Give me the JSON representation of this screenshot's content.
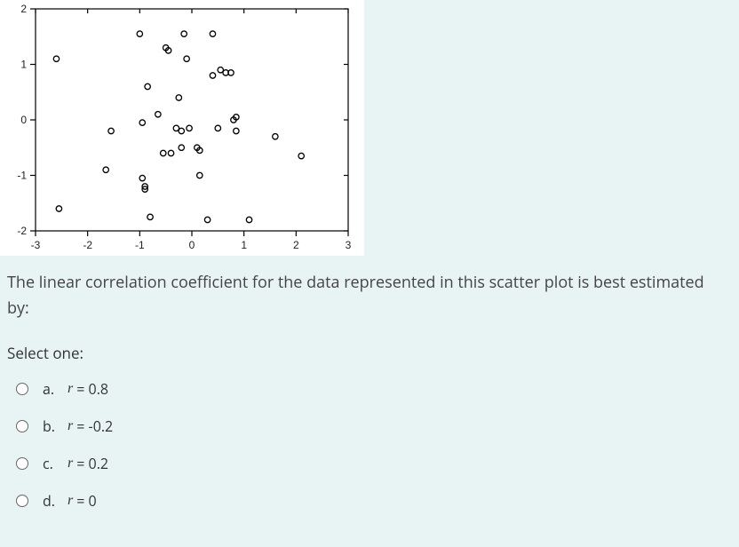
{
  "chart_data": {
    "type": "scatter",
    "title": "",
    "xlabel": "",
    "ylabel": "",
    "xlim": [
      -3,
      3
    ],
    "ylim": [
      -2,
      2
    ],
    "xticks": [
      -3,
      -2,
      -1,
      0,
      1,
      2,
      3
    ],
    "yticks": [
      -2,
      -1,
      0,
      1,
      2
    ],
    "points": [
      {
        "x": -2.6,
        "y": 1.1
      },
      {
        "x": -2.55,
        "y": -1.6
      },
      {
        "x": -1.65,
        "y": -0.9
      },
      {
        "x": -1.55,
        "y": -0.2
      },
      {
        "x": -1.0,
        "y": 1.55
      },
      {
        "x": -0.95,
        "y": -0.05
      },
      {
        "x": -0.95,
        "y": -1.05
      },
      {
        "x": -0.9,
        "y": -1.2
      },
      {
        "x": -0.9,
        "y": -1.25
      },
      {
        "x": -0.85,
        "y": 0.6
      },
      {
        "x": -0.8,
        "y": -1.75
      },
      {
        "x": -0.65,
        "y": 0.1
      },
      {
        "x": -0.55,
        "y": -0.6
      },
      {
        "x": -0.5,
        "y": 1.3
      },
      {
        "x": -0.45,
        "y": 1.25
      },
      {
        "x": -0.4,
        "y": -0.6
      },
      {
        "x": -0.3,
        "y": -0.15
      },
      {
        "x": -0.25,
        "y": 0.4
      },
      {
        "x": -0.2,
        "y": -0.2
      },
      {
        "x": -0.2,
        "y": -0.5
      },
      {
        "x": -0.15,
        "y": 1.55
      },
      {
        "x": -0.1,
        "y": 1.1
      },
      {
        "x": -0.05,
        "y": -0.15
      },
      {
        "x": 0.1,
        "y": -0.5
      },
      {
        "x": 0.15,
        "y": -0.55
      },
      {
        "x": 0.15,
        "y": -1.0
      },
      {
        "x": 0.3,
        "y": -1.8
      },
      {
        "x": 0.4,
        "y": 1.55
      },
      {
        "x": 0.4,
        "y": 0.8
      },
      {
        "x": 0.5,
        "y": -0.15
      },
      {
        "x": 0.55,
        "y": 0.9
      },
      {
        "x": 0.65,
        "y": 0.85
      },
      {
        "x": 0.75,
        "y": 0.85
      },
      {
        "x": 0.8,
        "y": 0.0
      },
      {
        "x": 0.85,
        "y": 0.05
      },
      {
        "x": 0.85,
        "y": -0.2
      },
      {
        "x": 1.1,
        "y": -1.8
      },
      {
        "x": 1.6,
        "y": -0.3
      },
      {
        "x": 2.1,
        "y": -0.65
      }
    ]
  },
  "question": "The linear correlation coefficient for the data represented in this scatter plot is best estimated by:",
  "select_one_label": "Select one:",
  "options": [
    {
      "letter": "a.",
      "variable": "r",
      "rest": " = 0.8"
    },
    {
      "letter": "b.",
      "variable": "r",
      "rest": " = -0.2"
    },
    {
      "letter": "c.",
      "variable": "r",
      "rest": " = 0.2"
    },
    {
      "letter": "d.",
      "variable": "r",
      "rest": " = 0"
    }
  ]
}
